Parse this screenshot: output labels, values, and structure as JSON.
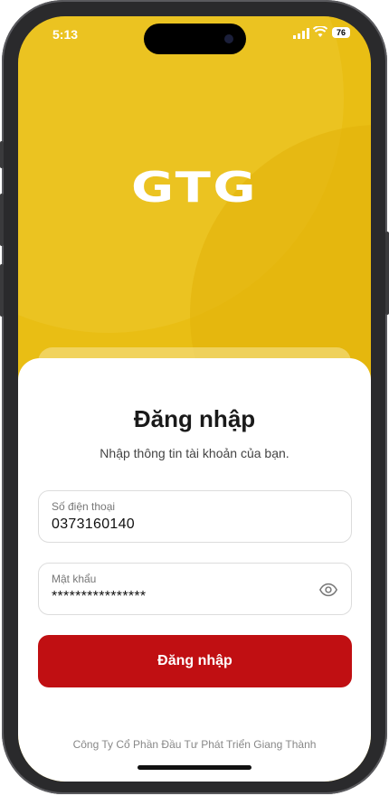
{
  "status_bar": {
    "time": "5:13",
    "battery": "76"
  },
  "brand": {
    "logo_text": "GTG",
    "background_color": "#e9be14"
  },
  "login": {
    "title": "Đăng nhập",
    "subtitle": "Nhập thông tin tài khoản của bạn.",
    "phone_field": {
      "label": "Số điện thoại",
      "value": "0373160140"
    },
    "password_field": {
      "label": "Mật khẩu",
      "value": "****************"
    },
    "submit_label": "Đăng nhập",
    "submit_color": "#c00f12"
  },
  "footer": {
    "company": "Công Ty Cổ Phần Đầu Tư Phát Triển Giang Thành"
  }
}
